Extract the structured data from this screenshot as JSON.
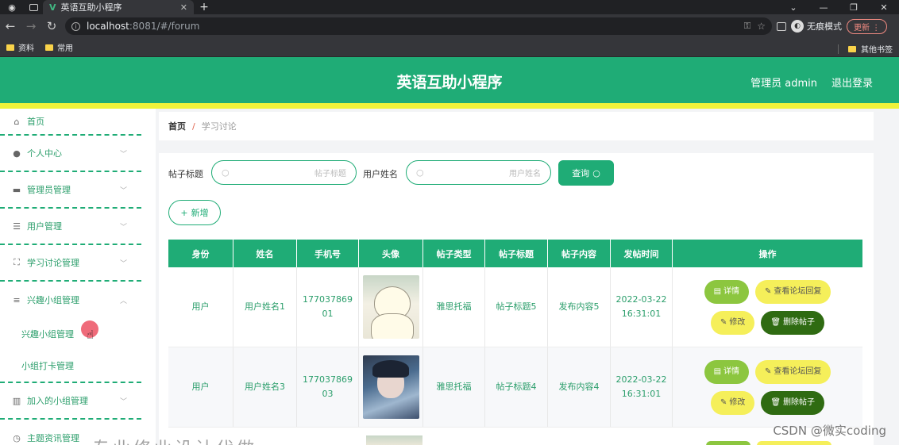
{
  "browser": {
    "tab_title": "英语互助小程序",
    "url_host": "localhost",
    "url_path": ":8081/#/forum",
    "incognito_label": "无痕模式",
    "update_label": "更新",
    "bookmarks": [
      "资料",
      "常用"
    ],
    "other_bookmarks": "其他书签"
  },
  "header": {
    "title": "英语互助小程序",
    "user": "管理员 admin",
    "logout": "退出登录"
  },
  "sidebar": {
    "items": [
      {
        "label": "首页",
        "icon": "home-icon"
      },
      {
        "label": "个人中心",
        "icon": "user-icon"
      },
      {
        "label": "管理员管理",
        "icon": "ticket-icon"
      },
      {
        "label": "用户管理",
        "icon": "list-icon"
      },
      {
        "label": "学习讨论管理",
        "icon": "fullscreen-icon"
      },
      {
        "label": "兴趣小组管理",
        "icon": "menu-icon"
      }
    ],
    "submenu": [
      "兴趣小组管理",
      "小组打卡管理"
    ],
    "after": [
      {
        "label": "加入的小组管理",
        "icon": "chart-icon"
      },
      {
        "label": "主题资讯管理",
        "icon": "clock-icon"
      }
    ]
  },
  "breadcrumb": {
    "home": "首页",
    "sep": "/",
    "current": "学习讨论"
  },
  "search": {
    "title_label": "帖子标题",
    "title_placeholder": "帖子标题",
    "name_label": "用户姓名",
    "name_placeholder": "用户姓名",
    "query_button": "查询",
    "add_button": "新增"
  },
  "table": {
    "headers": [
      "身份",
      "姓名",
      "手机号",
      "头像",
      "帖子类型",
      "帖子标题",
      "帖子内容",
      "发帖时间",
      "操作"
    ],
    "rows": [
      {
        "role": "用户",
        "name": "用户姓名1",
        "phone": "17703786901",
        "avatar": "bear",
        "type": "雅思托福",
        "title": "帖子标题5",
        "content": "发布内容5",
        "time": "2022-03-22 16:31:01"
      },
      {
        "role": "用户",
        "name": "用户姓名3",
        "phone": "17703786903",
        "avatar": "boy",
        "type": "雅思托福",
        "title": "帖子标题4",
        "content": "发布内容4",
        "time": "2022-03-22 16:31:01"
      }
    ],
    "actions": {
      "detail": "详情",
      "reply": "查看论坛回复",
      "edit": "修改",
      "delete": "删除帖子"
    }
  },
  "overlay_text": "专业修业设计代做",
  "watermark": "CSDN @微实coding",
  "colors": {
    "primary": "#1fac76",
    "strip": "#f0f33a",
    "detail": "#8cc63f",
    "reply": "#f5ef5a",
    "delete": "#2f6b12"
  }
}
